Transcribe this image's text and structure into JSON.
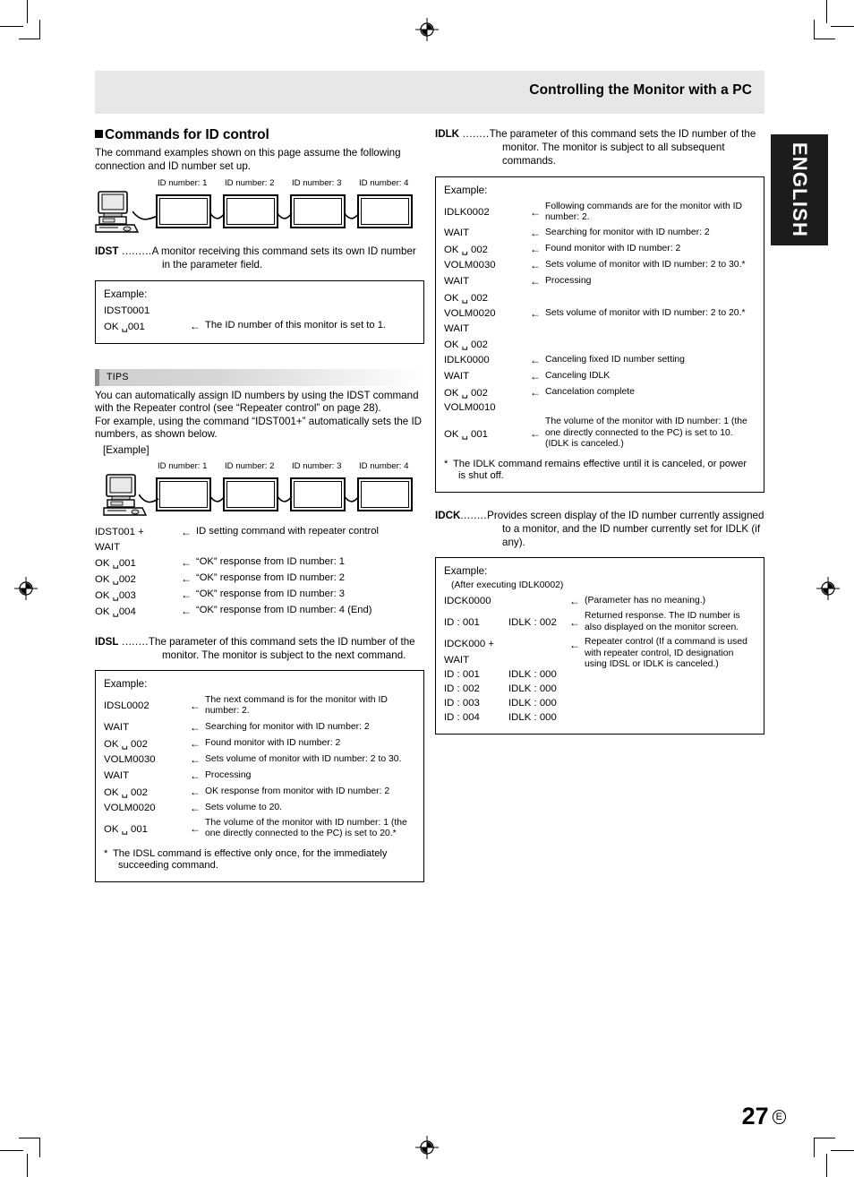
{
  "header": {
    "title": "Controlling the Monitor with a PC"
  },
  "lang_tab": {
    "label": "ENGLISH"
  },
  "page": {
    "number": "27",
    "suffix": "E"
  },
  "left": {
    "section_heading": "Commands for ID control",
    "intro": "The command examples shown on this page assume the following connection and ID number set up.",
    "diagram1": {
      "labels": [
        "ID number: 1",
        "ID number: 2",
        "ID number: 3",
        "ID number: 4"
      ]
    },
    "idst": {
      "name": "IDST",
      "dots": " .........",
      "desc": "A monitor receiving this command sets its own ID number in the parameter field.",
      "example_label": "Example:",
      "rows": [
        {
          "cmd": "IDST0001",
          "arrow": "",
          "text": ""
        },
        {
          "cmd": "OK ␣001",
          "arrow": "←",
          "text": "The ID number of this monitor is set to 1."
        }
      ]
    },
    "tips": {
      "label": "TIPS",
      "body1": "You can automatically assign ID numbers by using the IDST command with the Repeater control (see “Repeater control” on page 28).",
      "body2": "For example, using the command “IDST001+” automatically sets the ID numbers, as shown below.",
      "example_label": "[Example]",
      "diagram_labels": [
        "ID number: 1",
        "ID number: 2",
        "ID number: 3",
        "ID number: 4"
      ],
      "rows": [
        {
          "cmd": "IDST001 +",
          "arrow": "←",
          "text": "ID setting command with repeater control"
        },
        {
          "cmd": "WAIT",
          "arrow": "",
          "text": ""
        },
        {
          "cmd": "OK ␣001",
          "arrow": "←",
          "text": "“OK” response from ID number: 1"
        },
        {
          "cmd": "OK ␣002",
          "arrow": "←",
          "text": "“OK” response from ID number: 2"
        },
        {
          "cmd": "OK ␣003",
          "arrow": "←",
          "text": "“OK” response from ID number: 3"
        },
        {
          "cmd": "OK ␣004",
          "arrow": "←",
          "text": "“OK” response from ID number: 4 (End)"
        }
      ]
    },
    "idsl": {
      "name": "IDSL",
      "dots": " ........",
      "desc": "The parameter of this command sets the ID number of the monitor. The monitor is subject to the next command.",
      "example_label": "Example:",
      "rows": [
        {
          "cmd": "IDSL0002",
          "arrow": "←",
          "text": "The next command is for the monitor with ID number: 2."
        },
        {
          "cmd": "WAIT",
          "arrow": "←",
          "text": "Searching for monitor with ID number: 2"
        },
        {
          "cmd": "OK ␣ 002",
          "arrow": "←",
          "text": "Found monitor with ID number: 2"
        },
        {
          "cmd": "VOLM0030",
          "arrow": "←",
          "text": "Sets volume of monitor with ID number: 2 to 30."
        },
        {
          "cmd": "WAIT",
          "arrow": "←",
          "text": "Processing"
        },
        {
          "cmd": "OK ␣ 002",
          "arrow": "←",
          "text": "OK response from monitor with ID number: 2"
        },
        {
          "cmd": "VOLM0020",
          "arrow": "←",
          "text": "Sets volume to 20."
        },
        {
          "cmd": "OK ␣ 001",
          "arrow": "←",
          "text": "The volume of the monitor with ID number: 1 (the one directly connected to the PC) is set to 20.*"
        }
      ],
      "note": "* The IDSL command is effective only once, for the immediately succeeding command."
    }
  },
  "right": {
    "idlk": {
      "name": "IDLK",
      "dots": " ........",
      "desc": "The parameter of this command sets the ID number of the monitor. The monitor is subject to all subsequent commands.",
      "example_label": "Example:",
      "rows": [
        {
          "cmd": "IDLK0002",
          "arrow": "←",
          "text": "Following commands are for the monitor with ID number: 2."
        },
        {
          "cmd": "WAIT",
          "arrow": "←",
          "text": "Searching for monitor with ID number: 2"
        },
        {
          "cmd": "OK ␣ 002",
          "arrow": "←",
          "text": "Found monitor with ID number: 2"
        },
        {
          "cmd": "VOLM0030",
          "arrow": "←",
          "text": "Sets volume of monitor with ID number: 2 to 30.*"
        },
        {
          "cmd": "WAIT",
          "arrow": "←",
          "text": "Processing"
        },
        {
          "cmd": "OK ␣ 002",
          "arrow": "",
          "text": ""
        },
        {
          "cmd": "VOLM0020",
          "arrow": "←",
          "text": "Sets volume of monitor with ID number: 2 to 20.*"
        },
        {
          "cmd": "WAIT",
          "arrow": "",
          "text": ""
        },
        {
          "cmd": "OK ␣ 002",
          "arrow": "",
          "text": ""
        },
        {
          "cmd": "IDLK0000",
          "arrow": "←",
          "text": "Canceling fixed ID number setting"
        },
        {
          "cmd": "WAIT",
          "arrow": "←",
          "text": "Canceling IDLK"
        },
        {
          "cmd": "OK ␣ 002",
          "arrow": "←",
          "text": "Cancelation complete"
        },
        {
          "cmd": "VOLM0010",
          "arrow": "",
          "text": ""
        },
        {
          "cmd": "OK ␣ 001",
          "arrow": "←",
          "text": "The volume of the monitor with ID number: 1 (the one directly connected to the PC) is set to 10. (IDLK is canceled.)"
        }
      ],
      "note": "* The IDLK command remains effective until it is canceled, or power is shut off."
    },
    "idck": {
      "name": "IDCK",
      "dots": "........",
      "desc": "Provides screen display of the ID number currently assigned to a monitor, and the ID number currently set for IDLK (if any).",
      "example_label": "Example:",
      "example_sub": "(After executing IDLK0002)",
      "rows": [
        {
          "cmd": "IDCK0000",
          "cmd2": "",
          "arrow": "←",
          "text": "(Parameter has no meaning.)"
        },
        {
          "cmd": "ID : 001",
          "cmd2": "IDLK : 002",
          "arrow": "←",
          "text": "Returned response. The ID number is also displayed on the monitor screen."
        },
        {
          "cmd": "IDCK000 +",
          "cmd2": "",
          "arrow": "←",
          "text": "Repeater control (If a command is used with repeater control, ID designation using IDSL or IDLK is canceled.)"
        },
        {
          "cmd": "WAIT",
          "cmd2": "",
          "arrow": "",
          "text": ""
        },
        {
          "cmd": "ID : 001",
          "cmd2": "IDLK : 000",
          "arrow": "",
          "text": ""
        },
        {
          "cmd": "ID : 002",
          "cmd2": "IDLK : 000",
          "arrow": "",
          "text": ""
        },
        {
          "cmd": "ID : 003",
          "cmd2": "IDLK : 000",
          "arrow": "",
          "text": ""
        },
        {
          "cmd": "ID : 004",
          "cmd2": "IDLK : 000",
          "arrow": "",
          "text": ""
        }
      ]
    }
  }
}
